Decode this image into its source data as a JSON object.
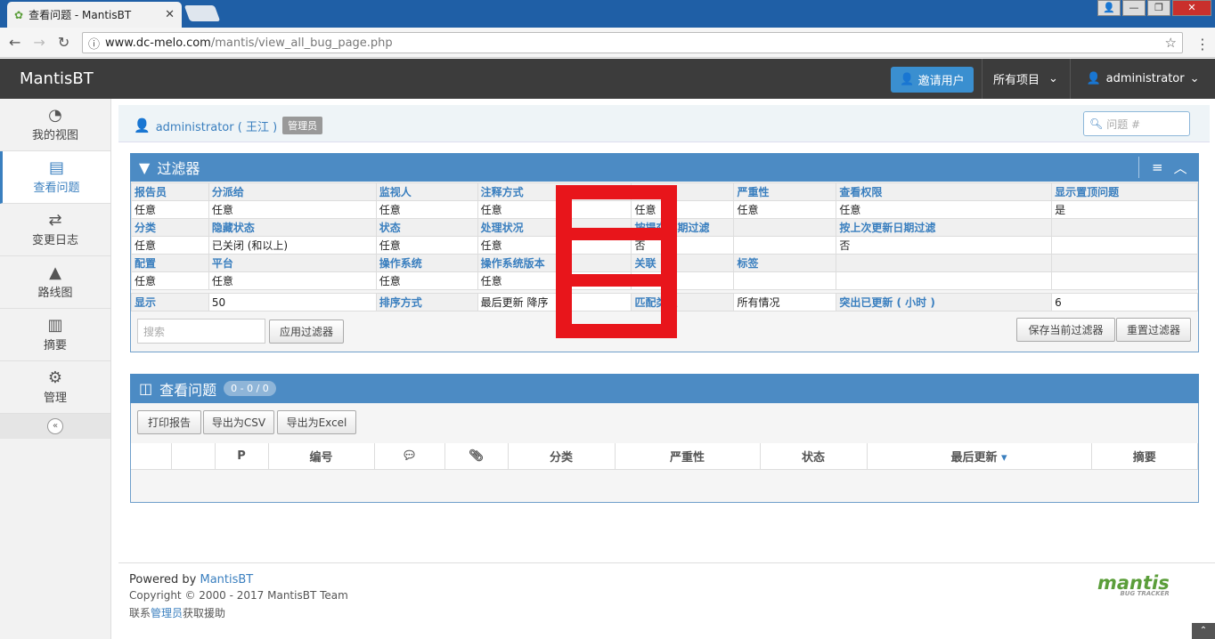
{
  "browser": {
    "tab_title": "查看问题 - MantisBT",
    "tab_close": "✕",
    "url_host": "www.dc-melo.com",
    "url_path": "/mantis/view_all_bug_page.php",
    "win_buttons": [
      "👤",
      "—",
      "❐",
      "✕"
    ]
  },
  "header": {
    "brand": "MantisBT",
    "invite_label": "邀请用户",
    "projects_label": "所有项目",
    "user_label": "administrator"
  },
  "sidebar": {
    "items": [
      {
        "label": "我的视图",
        "icon": "dashboard-icon"
      },
      {
        "label": "查看问题",
        "icon": "list-icon"
      },
      {
        "label": "变更日志",
        "icon": "retweet-icon"
      },
      {
        "label": "路线图",
        "icon": "road-icon"
      },
      {
        "label": "摘要",
        "icon": "bar-chart-icon"
      },
      {
        "label": "管理",
        "icon": "gears-icon"
      }
    ]
  },
  "breadcrumb": {
    "user": "administrator ( 王江 )",
    "role": "管理员",
    "issue_placeholder": "问题 #"
  },
  "filter": {
    "title": "过滤器",
    "rows": [
      {
        "headers": [
          "报告员",
          "分派给",
          "监视人",
          "注释方式",
          "",
          "严重性",
          "查看权限",
          "显示置顶问题"
        ],
        "values": [
          "任意",
          "任意",
          "任意",
          "任意",
          "任意",
          "任意",
          "任意",
          "是"
        ]
      },
      {
        "headers": [
          "分类",
          "隐藏状态",
          "状态",
          "处理状况",
          "按提交日期过滤",
          "",
          "按上次更新日期过滤",
          ""
        ],
        "values": [
          "任意",
          "已关闭 (和以上)",
          "任意",
          "任意",
          "否",
          "",
          "否",
          ""
        ]
      },
      {
        "headers": [
          "配置",
          "平台",
          "操作系统",
          "操作系统版本",
          "关联",
          "标签",
          "",
          ""
        ],
        "values": [
          "任意",
          "任意",
          "任意",
          "任意",
          "任意",
          "",
          "",
          ""
        ]
      }
    ],
    "display_row": [
      "显示",
      "50",
      "排序方式",
      "最后更新 降序",
      "匹配类型",
      "所有情况",
      "突出已更新 ( 小时 )",
      "6"
    ],
    "search_placeholder": "搜索",
    "apply_label": "应用过滤器",
    "save_label": "保存当前过滤器",
    "reset_label": "重置过滤器"
  },
  "issues": {
    "title": "查看问题",
    "count": "0 - 0 / 0",
    "print_label": "打印报告",
    "csv_label": "导出为CSV",
    "excel_label": "导出为Excel",
    "columns": [
      "",
      "",
      "P",
      "编号",
      "",
      "",
      "分类",
      "严重性",
      "状态",
      "最后更新",
      "摘要"
    ]
  },
  "footer": {
    "powered_prefix": "Powered by ",
    "powered_link": "MantisBT",
    "copyright": "Copyright © 2000 - 2017 MantisBT Team",
    "contact_prefix": "联系",
    "contact_link": "管理员",
    "contact_suffix": "获取援助",
    "logo_text": "mantis",
    "logo_sub": "BUG TRACKER"
  },
  "colors": {
    "accent": "#4c8bc4",
    "header_bg": "#3c3c3c",
    "overlay_red": "#e8151b",
    "invite_btn": "#3a8fd0"
  }
}
